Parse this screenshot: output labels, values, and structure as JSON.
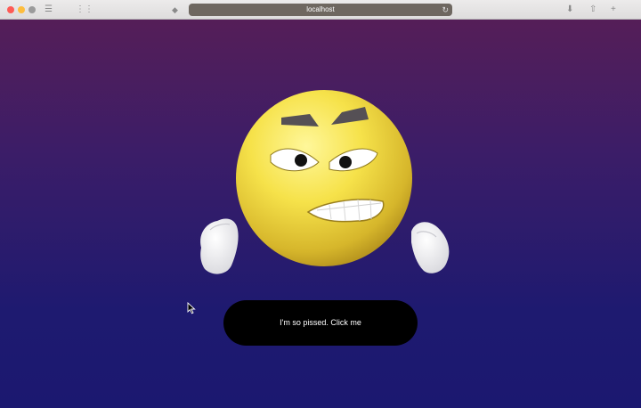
{
  "browser": {
    "url": "localhost",
    "traffic_lights": {
      "close": "#fd5b55",
      "minimize": "#fdbd3d",
      "zoom": "#9b9b9b"
    }
  },
  "page": {
    "gradient_top": "#551e58",
    "gradient_bottom": "#1b1870",
    "button": {
      "label": "I'm so pissed. Click me",
      "background": "#000000",
      "text_color": "#ffffff"
    },
    "emoji": {
      "expression": "angry",
      "face_color": "#f6e24a"
    }
  }
}
